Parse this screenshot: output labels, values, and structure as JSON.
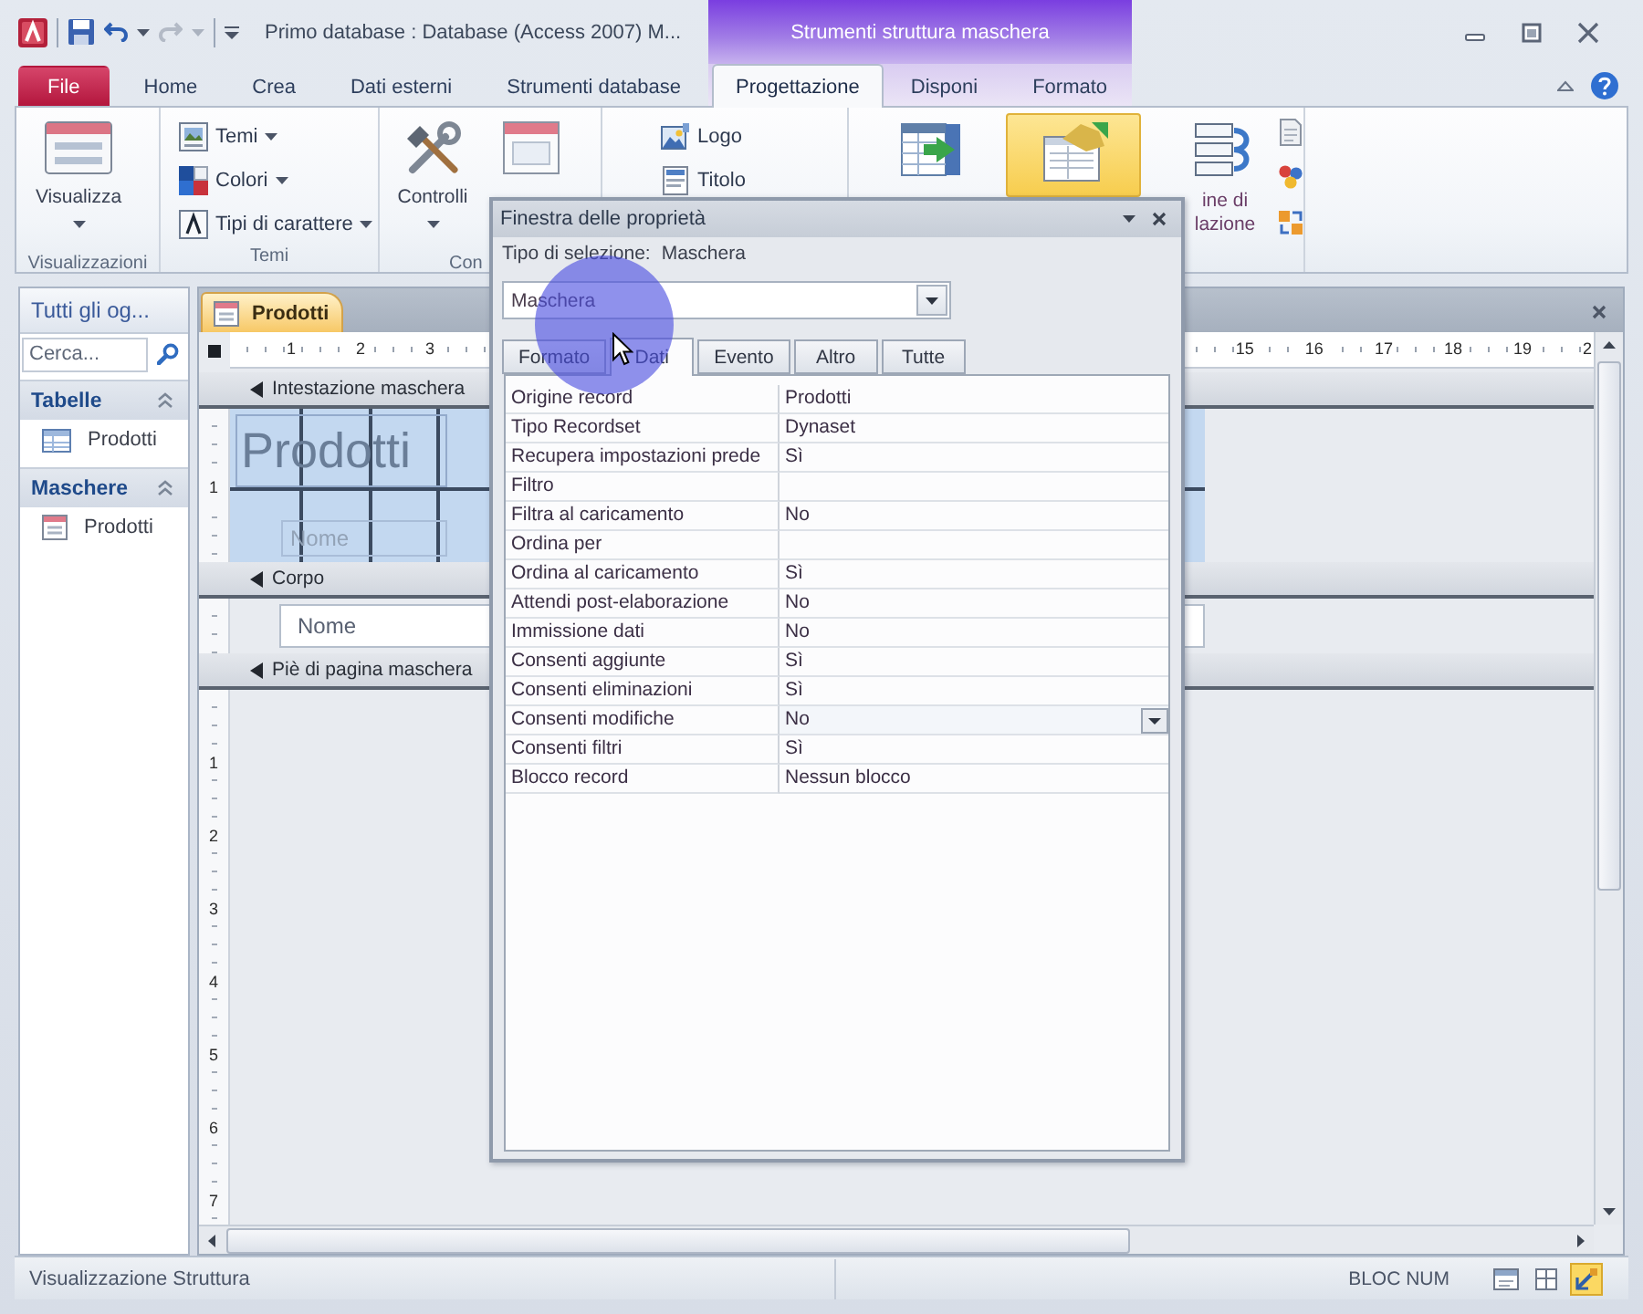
{
  "window": {
    "title": "Primo database : Database (Access 2007) M...",
    "contextual_title": "Strumenti struttura maschera"
  },
  "ribbon_tabs": [
    {
      "label": "File",
      "kind": "file",
      "selected": false
    },
    {
      "label": "Home",
      "kind": "normal",
      "selected": false
    },
    {
      "label": "Crea",
      "kind": "normal",
      "selected": false
    },
    {
      "label": "Dati esterni",
      "kind": "normal",
      "selected": false
    },
    {
      "label": "Strumenti database",
      "kind": "normal",
      "selected": false
    },
    {
      "label": "Progettazione",
      "kind": "contextual",
      "selected": true
    },
    {
      "label": "Disponi",
      "kind": "contextual",
      "selected": false
    },
    {
      "label": "Formato",
      "kind": "contextual",
      "selected": false
    }
  ],
  "ribbon_groups": [
    {
      "label": "Visualizzazioni",
      "commands": [
        {
          "label": "Visualizza",
          "kind": "large",
          "dropdown": true,
          "selected": false
        }
      ]
    },
    {
      "label": "Temi",
      "commands": [
        {
          "label": "Temi",
          "kind": "small",
          "dropdown": true,
          "selected": false
        },
        {
          "label": "Colori",
          "kind": "small",
          "dropdown": true,
          "selected": false
        },
        {
          "label": "Tipi di carattere",
          "kind": "small",
          "dropdown": true,
          "selected": false
        }
      ]
    },
    {
      "label": "Con",
      "commands": [
        {
          "label": "Controlli",
          "kind": "large",
          "dropdown": true,
          "selected": false
        },
        {
          "kind": "large",
          "selected": false
        }
      ]
    },
    {
      "commands": [
        {
          "label": "Logo",
          "kind": "small",
          "selected": false
        },
        {
          "label": "Titolo",
          "kind": "small",
          "selected": false
        }
      ]
    },
    {
      "commands": [
        {
          "kind": "large",
          "selected": false
        },
        {
          "kind": "large",
          "selected": true
        },
        {
          "label_lines": [
            "ine di",
            "lazione"
          ],
          "kind": "large",
          "selected": false
        },
        {
          "kind": "tiny",
          "selected": false
        },
        {
          "kind": "tiny",
          "selected": false
        },
        {
          "kind": "tiny",
          "selected": false
        }
      ]
    }
  ],
  "navigation": {
    "title": "Tutti gli og...",
    "search_placeholder": "Cerca...",
    "groups": [
      {
        "label": "Tabelle",
        "expanded": true,
        "items": [
          {
            "label": "Prodotti",
            "kind": "table",
            "selected": false
          }
        ]
      },
      {
        "label": "Maschere",
        "expanded": true,
        "items": [
          {
            "label": "Prodotti",
            "kind": "form",
            "selected": false
          }
        ]
      }
    ]
  },
  "document_tabs": [
    {
      "label": "Prodotti",
      "selected": true
    }
  ],
  "rulers": {
    "left_numbers": [
      "1",
      "2",
      "3"
    ],
    "right_numbers": [
      "15",
      "16",
      "17",
      "18",
      "19",
      "2"
    ]
  },
  "form_design": {
    "sections": [
      {
        "label": "Intestazione maschera",
        "kind": "header",
        "ruler_numbers": [
          "1"
        ],
        "controls": [
          {
            "text": "Prodotti",
            "kind": "title"
          },
          {
            "text": "Nome",
            "kind": "label"
          }
        ]
      },
      {
        "label": "Corpo",
        "kind": "detail",
        "controls": [
          {
            "text": "Nome",
            "kind": "textbox"
          }
        ]
      },
      {
        "label": "Piè di pagina maschera",
        "kind": "footer",
        "ruler_numbers": [
          "1",
          "2",
          "3",
          "4",
          "5",
          "6",
          "7"
        ]
      }
    ]
  },
  "property_sheet": {
    "title": "Finestra delle proprietà",
    "selection_label": "Tipo di selezione:",
    "selection_type": "Maschera",
    "object_value": "Maschera",
    "tabs": [
      {
        "label": "Formato",
        "selected": false
      },
      {
        "label": "Dati",
        "selected": true
      },
      {
        "label": "Evento",
        "selected": false
      },
      {
        "label": "Altro",
        "selected": false
      },
      {
        "label": "Tutte",
        "selected": false
      }
    ],
    "properties": [
      {
        "name": "Origine record",
        "value": "Prodotti",
        "selected": false
      },
      {
        "name": "Tipo Recordset",
        "value": "Dynaset",
        "selected": false
      },
      {
        "name": "Recupera impostazioni prede",
        "value": "Sì",
        "selected": false
      },
      {
        "name": "Filtro",
        "selected": false
      },
      {
        "name": "Filtra al caricamento",
        "value": "No",
        "selected": false
      },
      {
        "name": "Ordina per",
        "selected": false
      },
      {
        "name": "Ordina al caricamento",
        "value": "Sì",
        "selected": false
      },
      {
        "name": "Attendi post-elaborazione",
        "value": "No",
        "selected": false
      },
      {
        "name": "Immissione dati",
        "value": "No",
        "selected": false
      },
      {
        "name": "Consenti aggiunte",
        "value": "Sì",
        "selected": false
      },
      {
        "name": "Consenti eliminazioni",
        "value": "Sì",
        "selected": false
      },
      {
        "name": "Consenti modifiche",
        "value": "No",
        "selected": true
      },
      {
        "name": "Consenti filtri",
        "value": "Sì",
        "selected": false
      },
      {
        "name": "Blocco record",
        "value": "Nessun blocco",
        "selected": false
      }
    ]
  },
  "status_bar": {
    "text": "Visualizzazione Struttura",
    "indicator": "BLOC NUM",
    "views": [
      {
        "kind": "form",
        "selected": false
      },
      {
        "kind": "layout",
        "selected": false
      },
      {
        "kind": "design",
        "selected": true
      }
    ]
  }
}
